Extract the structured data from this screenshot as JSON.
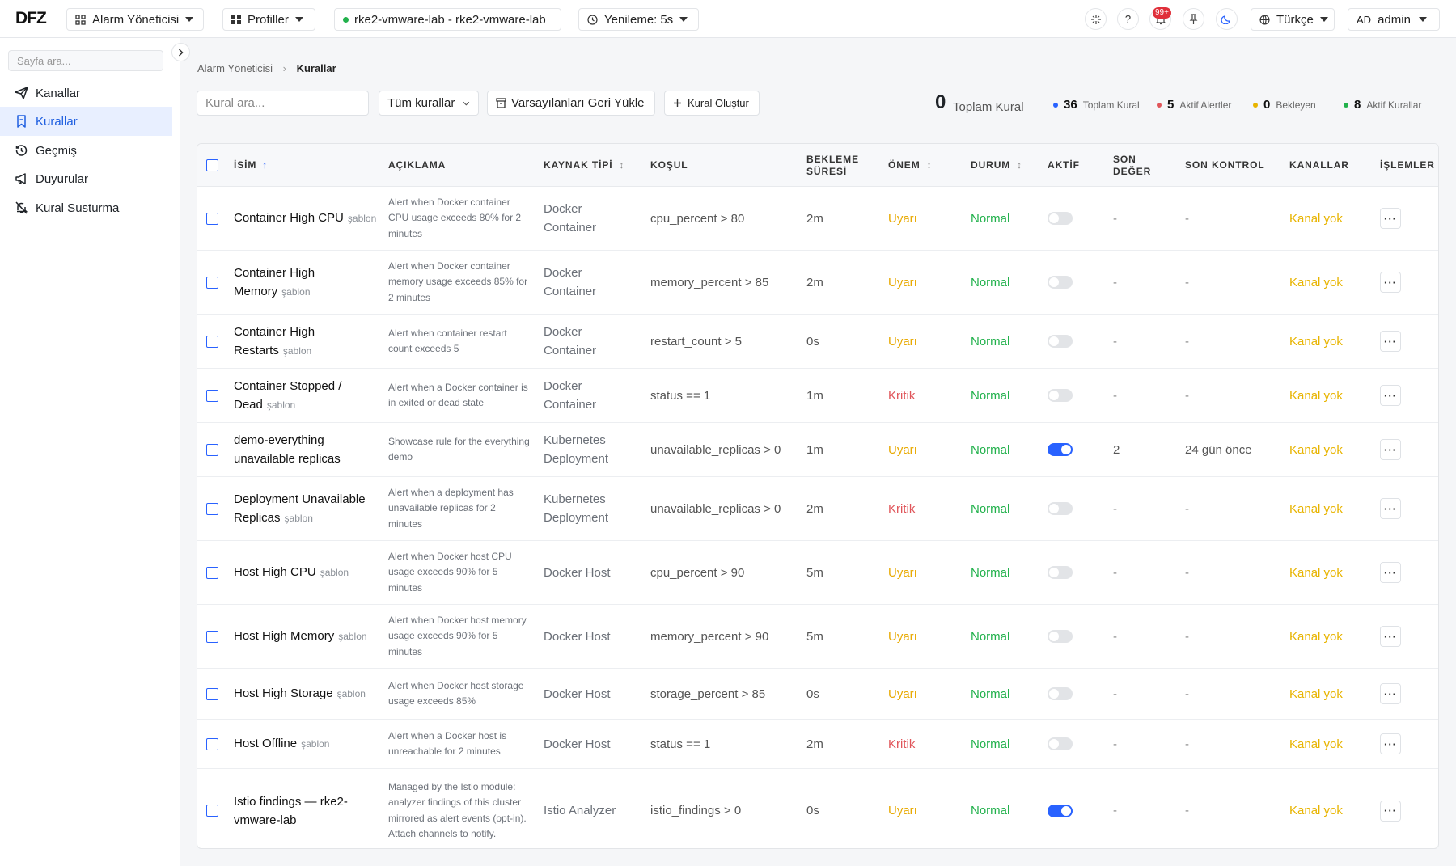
{
  "topbar": {
    "logo": "DFZ",
    "module_label": "Alarm Yöneticisi",
    "profiles_label": "Profiller",
    "cluster_label": "rke2-vmware-lab - rke2-vmware-lab",
    "refresh_label": "Yenileme:",
    "refresh_value": "5s",
    "notif_badge": "99+",
    "language_label": "Türkçe",
    "user_initials": "AD",
    "user_name": "admin",
    "help_glyph": "?"
  },
  "sidebar": {
    "search_placeholder": "Sayfa ara...",
    "items": [
      {
        "label": "Kanallar",
        "icon": "send-icon"
      },
      {
        "label": "Kurallar",
        "icon": "bookmark-icon"
      },
      {
        "label": "Geçmiş",
        "icon": "history-icon"
      },
      {
        "label": "Duyurular",
        "icon": "megaphone-icon"
      },
      {
        "label": "Kural Susturma",
        "icon": "bell-off-icon"
      }
    ]
  },
  "breadcrumb": {
    "parent": "Alarm Yöneticisi",
    "current": "Kurallar"
  },
  "toolbar": {
    "search_placeholder": "Kural ara...",
    "filter_label": "Tüm kurallar",
    "restore_label": "Varsayılanları Geri Yükle",
    "create_label": "Kural Oluştur"
  },
  "stats": {
    "total_count": "0",
    "total_label": "Toplam Kural",
    "items": [
      {
        "value": "36",
        "label": "Toplam Kural",
        "color": "#2962ff"
      },
      {
        "value": "5",
        "label": "Aktif Alertler",
        "color": "#e0555a"
      },
      {
        "value": "0",
        "label": "Bekleyen",
        "color": "#e8b400"
      },
      {
        "value": "8",
        "label": "Aktif Kurallar",
        "color": "#22b14c"
      }
    ]
  },
  "table": {
    "headers": {
      "name": "İSİM",
      "desc": "AÇIKLAMA",
      "source": "KAYNAK TİPİ",
      "cond": "KOŞUL",
      "wait1": "BEKLEME",
      "wait2": "SÜRESİ",
      "sev": "ÖNEM",
      "status": "DURUM",
      "active": "AKTİF",
      "last1": "SON",
      "last2": "DEĞER",
      "check": "SON KONTROL",
      "chan": "KANALLAR",
      "ops": "İŞLEMLER"
    },
    "rows": [
      {
        "name": "Container High CPU",
        "tpl": "şablon",
        "desc": "Alert when Docker container CPU usage exceeds 80% for 2 minutes",
        "source": "Docker Container",
        "cond": "cpu_percent > 80",
        "wait": "2m",
        "sev": "Uyarı",
        "status": "Normal",
        "active": false,
        "last": "-",
        "check": "-",
        "chan": "Kanal yok"
      },
      {
        "name": "Container High Memory",
        "tpl": "şablon",
        "desc": "Alert when Docker container memory usage exceeds 85% for 2 minutes",
        "source": "Docker Container",
        "cond": "memory_percent > 85",
        "wait": "2m",
        "sev": "Uyarı",
        "status": "Normal",
        "active": false,
        "last": "-",
        "check": "-",
        "chan": "Kanal yok"
      },
      {
        "name": "Container High Restarts",
        "tpl": "şablon",
        "desc": "Alert when container restart count exceeds 5",
        "source": "Docker Container",
        "cond": "restart_count > 5",
        "wait": "0s",
        "sev": "Uyarı",
        "status": "Normal",
        "active": false,
        "last": "-",
        "check": "-",
        "chan": "Kanal yok"
      },
      {
        "name": "Container Stopped / Dead",
        "tpl": "şablon",
        "desc": "Alert when a Docker container is in exited or dead state",
        "source": "Docker Container",
        "cond": "status == 1",
        "wait": "1m",
        "sev": "Kritik",
        "status": "Normal",
        "active": false,
        "last": "-",
        "check": "-",
        "chan": "Kanal yok"
      },
      {
        "name": "demo-everything unavailable replicas",
        "tpl": "",
        "desc": "Showcase rule for the everything demo",
        "source": "Kubernetes Deployment",
        "cond": "unavailable_replicas > 0",
        "wait": "1m",
        "sev": "Uyarı",
        "status": "Normal",
        "active": true,
        "last": "2",
        "check": "24 gün önce",
        "chan": "Kanal yok"
      },
      {
        "name": "Deployment Unavailable Replicas",
        "tpl": "şablon",
        "desc": "Alert when a deployment has unavailable replicas for 2 minutes",
        "source": "Kubernetes Deployment",
        "cond": "unavailable_replicas > 0",
        "wait": "2m",
        "sev": "Kritik",
        "status": "Normal",
        "active": false,
        "last": "-",
        "check": "-",
        "chan": "Kanal yok"
      },
      {
        "name": "Host High CPU",
        "tpl": "şablon",
        "desc": "Alert when Docker host CPU usage exceeds 90% for 5 minutes",
        "source": "Docker Host",
        "cond": "cpu_percent > 90",
        "wait": "5m",
        "sev": "Uyarı",
        "status": "Normal",
        "active": false,
        "last": "-",
        "check": "-",
        "chan": "Kanal yok"
      },
      {
        "name": "Host High Memory",
        "tpl": "şablon",
        "desc": "Alert when Docker host memory usage exceeds 90% for 5 minutes",
        "source": "Docker Host",
        "cond": "memory_percent > 90",
        "wait": "5m",
        "sev": "Uyarı",
        "status": "Normal",
        "active": false,
        "last": "-",
        "check": "-",
        "chan": "Kanal yok"
      },
      {
        "name": "Host High Storage",
        "tpl": "şablon",
        "desc": "Alert when Docker host storage usage exceeds 85%",
        "source": "Docker Host",
        "cond": "storage_percent > 85",
        "wait": "0s",
        "sev": "Uyarı",
        "status": "Normal",
        "active": false,
        "last": "-",
        "check": "-",
        "chan": "Kanal yok"
      },
      {
        "name": "Host Offline",
        "tpl": "şablon",
        "desc": "Alert when a Docker host is unreachable for 2 minutes",
        "source": "Docker Host",
        "cond": "status == 1",
        "wait": "2m",
        "sev": "Kritik",
        "status": "Normal",
        "active": false,
        "last": "-",
        "check": "-",
        "chan": "Kanal yok"
      },
      {
        "name": "Istio findings — rke2-vmware-lab",
        "tpl": "",
        "desc": "Managed by the Istio module: analyzer findings of this cluster mirrored as alert events (opt-in). Attach channels to notify.",
        "source": "Istio Analyzer",
        "cond": "istio_findings > 0",
        "wait": "0s",
        "sev": "Uyarı",
        "status": "Normal",
        "active": true,
        "last": "-",
        "check": "-",
        "chan": "Kanal yok"
      }
    ]
  }
}
